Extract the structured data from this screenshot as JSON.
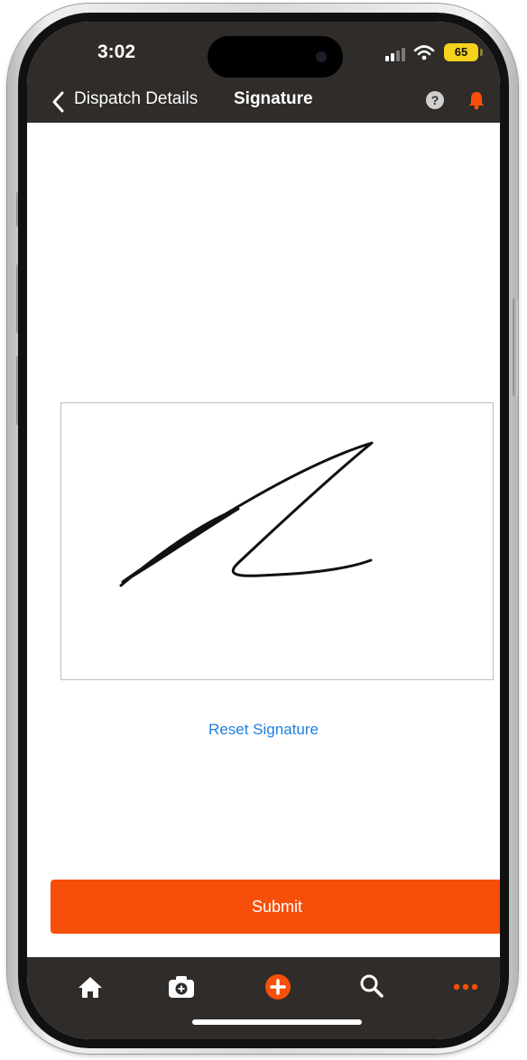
{
  "status_bar": {
    "time": "3:02",
    "battery_level": "65"
  },
  "nav": {
    "back_label": "Dispatch Details",
    "title": "Signature",
    "help_symbol": "?"
  },
  "signature": {
    "reset_label": "Reset Signature"
  },
  "actions": {
    "submit_label": "Submit"
  },
  "tab_bar": {
    "items": [
      "home-icon",
      "camera-icon",
      "add-icon",
      "search-icon",
      "more-icon"
    ]
  },
  "colors": {
    "header_bg": "#2f2c29",
    "accent_orange": "#f74f0a",
    "link_blue": "#1f7fe0",
    "battery_yellow": "#f6d21c"
  }
}
